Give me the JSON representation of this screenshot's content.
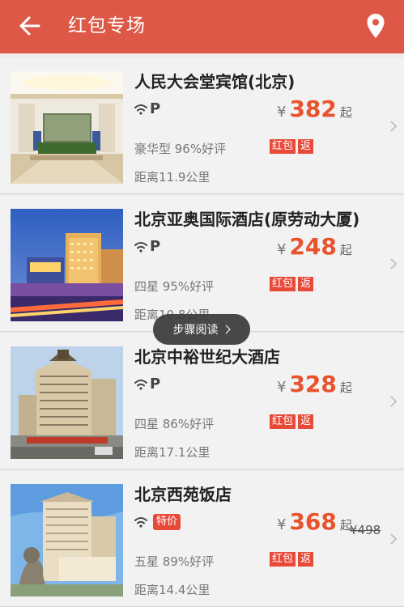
{
  "header": {
    "title": "红包专场"
  },
  "colors": {
    "primary": "#dd5846",
    "price": "#e8532d",
    "tag": "#e84a3a"
  },
  "currency": "¥",
  "price_suffix": "起",
  "hotels": [
    {
      "name": "人民大会堂宾馆(北京)",
      "amenity": "P",
      "price": "382",
      "rating": "豪华型 96%好评",
      "tags": [
        "红包",
        "返"
      ],
      "distance": "距离11.9公里"
    },
    {
      "name": "北京亚奥国际酒店(原劳动大厦)",
      "amenity": "P",
      "price": "248",
      "rating": "四星 95%好评",
      "tags": [
        "红包",
        "返"
      ],
      "distance": "距离10.8公里"
    },
    {
      "name": "北京中裕世纪大酒店",
      "amenity": "P",
      "price": "328",
      "rating": "四星 86%好评",
      "tags": [
        "红包",
        "返"
      ],
      "distance": "距离17.1公里"
    },
    {
      "name": "北京西苑饭店",
      "badge": "特价",
      "price": "368",
      "rating": "五星 89%好评",
      "tags": [
        "红包",
        "返"
      ],
      "distance": "距离14.4公里",
      "original_price": "¥498"
    }
  ],
  "toast": {
    "label": "步骤阅读"
  }
}
